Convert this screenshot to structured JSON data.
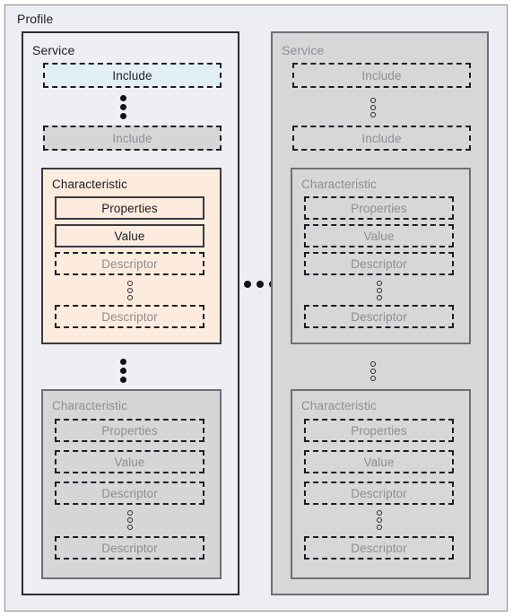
{
  "diagram": {
    "title": "Profile",
    "between_services_ellipsis": "•••",
    "colors": {
      "page_background": "#eceef3",
      "service_active_fill": "#eeeef4",
      "service_dimmed_fill": "#d7d7d7",
      "include_active_fill": "#e2f0f6",
      "include_dimmed_fill": "#d6d6d6",
      "characteristic_active_fill": "#fdecdd",
      "characteristic_dimmed_fill": "#d6d6d6",
      "text_active": "#1d1d26",
      "text_dimmed": "#8e8e95",
      "border_dark": "#1d1d26",
      "border_gray": "#6e6e74"
    },
    "services": [
      {
        "state": "active",
        "label": "Service",
        "includes": [
          {
            "label": "Include",
            "state": "active"
          },
          {
            "label": "Include",
            "state": "dimmed"
          }
        ],
        "include_ellipsis": "vertical-filled-dots",
        "characteristic_ellipsis": "vertical-filled-dots",
        "characteristics": [
          {
            "state": "active",
            "label": "Characteristic",
            "fields": [
              {
                "label": "Properties",
                "style": "solid",
                "state": "active"
              },
              {
                "label": "Value",
                "style": "solid",
                "state": "active"
              },
              {
                "label": "Descriptor",
                "style": "dashed",
                "state": "dimmed"
              },
              {
                "label": "Descriptor",
                "style": "dashed",
                "state": "dimmed"
              }
            ],
            "descriptor_ellipsis": "vertical-hollow-dots"
          },
          {
            "state": "dimmed",
            "label": "Characteristic",
            "fields": [
              {
                "label": "Properties",
                "style": "dashed",
                "state": "dimmed"
              },
              {
                "label": "Value",
                "style": "dashed",
                "state": "dimmed"
              },
              {
                "label": "Descriptor",
                "style": "dashed",
                "state": "dimmed"
              },
              {
                "label": "Descriptor",
                "style": "dashed",
                "state": "dimmed"
              }
            ],
            "descriptor_ellipsis": "vertical-hollow-dots"
          }
        ]
      },
      {
        "state": "dimmed",
        "label": "Service",
        "includes": [
          {
            "label": "Include",
            "state": "dimmed"
          },
          {
            "label": "Include",
            "state": "dimmed"
          }
        ],
        "include_ellipsis": "vertical-hollow-dots",
        "characteristic_ellipsis": "vertical-hollow-dots",
        "characteristics": [
          {
            "state": "dimmed",
            "label": "Characteristic",
            "fields": [
              {
                "label": "Properties",
                "style": "dashed",
                "state": "dimmed"
              },
              {
                "label": "Value",
                "style": "dashed",
                "state": "dimmed"
              },
              {
                "label": "Descriptor",
                "style": "dashed",
                "state": "dimmed"
              },
              {
                "label": "Descriptor",
                "style": "dashed",
                "state": "dimmed"
              }
            ],
            "descriptor_ellipsis": "vertical-hollow-dots"
          },
          {
            "state": "dimmed",
            "label": "Characteristic",
            "fields": [
              {
                "label": "Properties",
                "style": "dashed",
                "state": "dimmed"
              },
              {
                "label": "Value",
                "style": "dashed",
                "state": "dimmed"
              },
              {
                "label": "Descriptor",
                "style": "dashed",
                "state": "dimmed"
              },
              {
                "label": "Descriptor",
                "style": "dashed",
                "state": "dimmed"
              }
            ],
            "descriptor_ellipsis": "vertical-hollow-dots"
          }
        ]
      }
    ]
  }
}
